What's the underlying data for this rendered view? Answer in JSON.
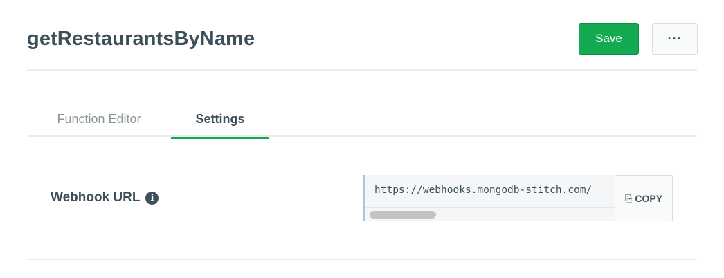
{
  "header": {
    "title": "getRestaurantsByName",
    "save_label": "Save",
    "more_label": "···"
  },
  "tabs": [
    {
      "label": "Function Editor",
      "active": false
    },
    {
      "label": "Settings",
      "active": true
    }
  ],
  "settings": {
    "webhook_label": "Webhook URL",
    "info_glyph": "i",
    "webhook_url": "https://webhooks.mongodb-stitch.com/",
    "copy_label": "COPY",
    "copy_icon_glyph": "⎘"
  },
  "colors": {
    "accent": "#13aa52",
    "text": "#3d4f58",
    "muted": "#89979b"
  },
  "icons": [
    "info-icon",
    "copy-icon",
    "more-icon"
  ]
}
